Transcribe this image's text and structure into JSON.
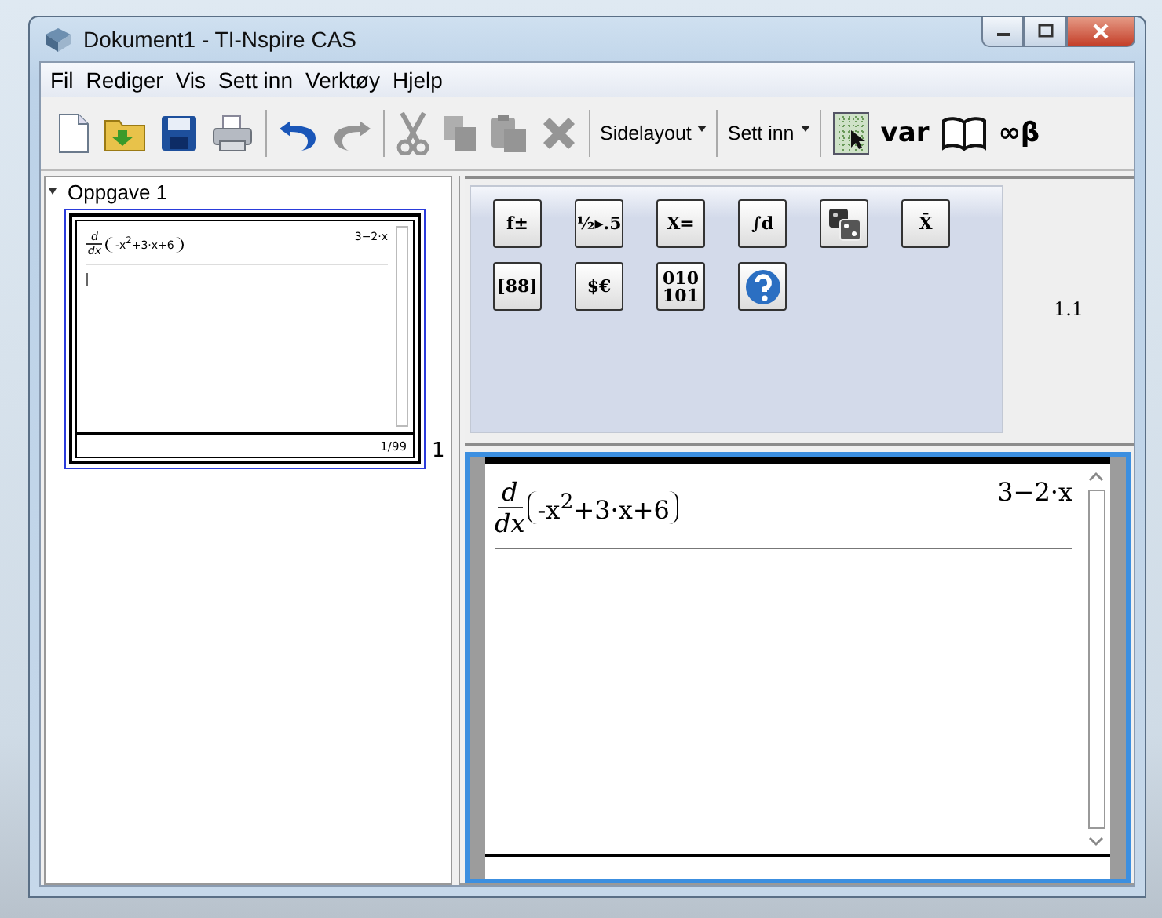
{
  "window": {
    "title": "Dokument1 - TI-Nspire CAS"
  },
  "menu": [
    "Fil",
    "Rediger",
    "Vis",
    "Sett inn",
    "Verktøy",
    "Hjelp"
  ],
  "toolbar": [
    {
      "kind": "icon",
      "disabled": false
    },
    {
      "kind": "icon",
      "disabled": false
    },
    {
      "kind": "icon",
      "disabled": false
    },
    {
      "kind": "icon",
      "disabled": false
    },
    {
      "kind": "separator"
    },
    {
      "kind": "icon",
      "disabled": false
    },
    {
      "kind": "icon",
      "disabled": true
    },
    {
      "kind": "separator"
    },
    {
      "kind": "icon",
      "disabled": true
    },
    {
      "kind": "icon",
      "disabled": true
    },
    {
      "kind": "icon",
      "disabled": true
    },
    {
      "kind": "icon",
      "disabled": true
    },
    {
      "kind": "separator"
    },
    {
      "kind": "dropdown",
      "label": "Sidelayout"
    },
    {
      "kind": "separator"
    },
    {
      "kind": "dropdown",
      "label": "Sett inn"
    },
    {
      "kind": "separator"
    },
    {
      "kind": "icon",
      "disabled": false
    },
    {
      "kind": "text",
      "label": "var"
    },
    {
      "kind": "icon",
      "disabled": false
    },
    {
      "kind": "text",
      "label": "∞β"
    }
  ],
  "sorter": {
    "problem": {
      "label": "Oppgave 1",
      "expanded": true
    },
    "pages": [
      {
        "number": "1",
        "selected": true,
        "entry": {
          "numerator": "d",
          "denominator": "dx",
          "expression": "-x$^{2}$+3·x+6",
          "result": "3−2·x"
        },
        "status": "1/99"
      }
    ]
  },
  "palette": {
    "buttons": [
      {
        "kind": "glyph",
        "symbol": "f±"
      },
      {
        "kind": "glyph",
        "symbol": "½▸.5"
      },
      {
        "kind": "glyph",
        "symbol": "X="
      },
      {
        "kind": "glyph",
        "symbol": "∫d"
      },
      {
        "kind": "icon"
      },
      {
        "kind": "glyph",
        "symbol": "X̄"
      },
      {
        "kind": "glyph",
        "symbol": "[88]"
      },
      {
        "kind": "glyph",
        "symbol": "$€"
      },
      {
        "kind": "glyph",
        "symbol": "010 101"
      },
      {
        "kind": "icon"
      }
    ],
    "page_label": "1.1"
  },
  "calculator": {
    "entries": [
      {
        "numerator": "d",
        "denominator": "dx",
        "expression": "-x$^{2}$+3·x+6",
        "result": "3−2·x"
      }
    ]
  }
}
